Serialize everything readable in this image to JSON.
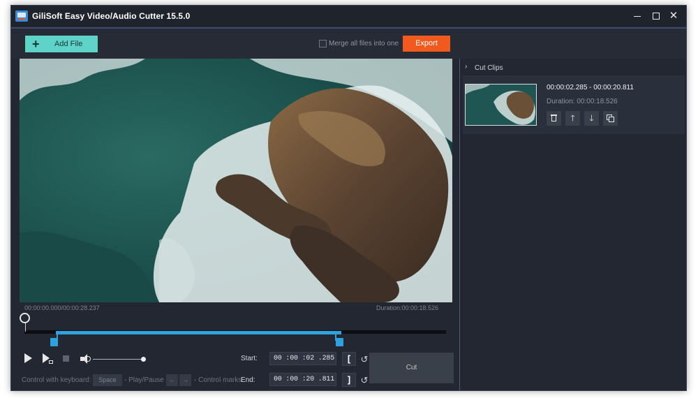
{
  "window": {
    "title": "GiliSoft Easy Video/Audio Cutter 15.5.0",
    "controls": {
      "minimize": "—",
      "maximize": "□",
      "close": "✕"
    }
  },
  "toolbar": {
    "add_file_label": "Add File",
    "add_file_icon": "+",
    "merge_label": "Merge all files into one",
    "merge_checked": false,
    "export_label": "Export"
  },
  "player": {
    "time_current": "00:00:00.000/00:00:28.237",
    "duration": "Duration:00:00:18.526",
    "playhead_fraction": 0.0,
    "selection_start_fraction": 0.081,
    "selection_end_fraction": 0.73,
    "volume_fraction": 1.0
  },
  "controls": {
    "keyboard_label": "Control with keyboard:",
    "space_key": "Space",
    "space_action": "- Play/Pause",
    "left_key": "←",
    "right_key": "→",
    "marks_action": "- Control marks"
  },
  "trim": {
    "start_label": "Start:",
    "start_value": "00 :00 :02 .285",
    "start_bracket": "[",
    "end_label": "End:",
    "end_value": "00 :00 :20 .811",
    "end_bracket": "]",
    "reset_icon": "↺",
    "cut_label": "Cut"
  },
  "clips": {
    "title": "Cut Clips",
    "chevron": "›",
    "items": [
      {
        "range": "00:00:02.285 - 00:00:20.811",
        "duration": "Duration:  00:00:18.526"
      }
    ],
    "actions": {
      "up": "🡑",
      "down": "🡓"
    }
  },
  "colors": {
    "accent_teal": "#5fd3c7",
    "export_orange": "#f05a1f",
    "selection_blue": "#2fa1dc",
    "background": "#222731"
  }
}
